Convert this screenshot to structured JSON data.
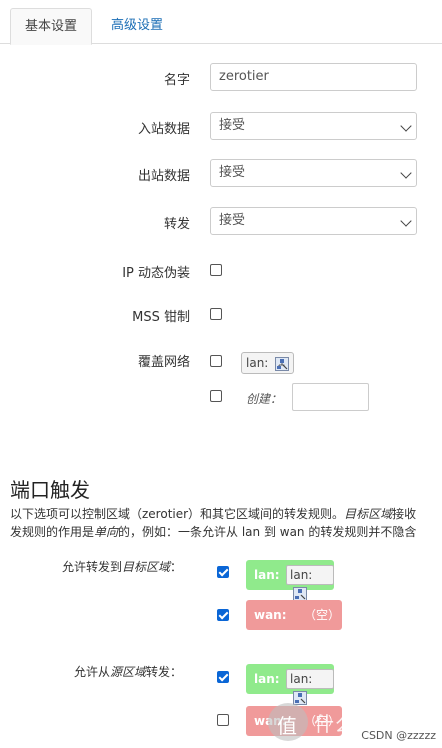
{
  "tabs": {
    "basic": "基本设置",
    "advanced": "高级设置"
  },
  "form": {
    "name_label": "名字",
    "name_value": "zerotier",
    "input_label": "入站数据",
    "input_value": "接受",
    "output_label": "出站数据",
    "output_value": "接受",
    "forward_label": "转发",
    "forward_value": "接受",
    "masq_label": "IP 动态伪装",
    "mss_label": "MSS 钳制",
    "covered_label": "覆盖网络",
    "covered_lan": "lan:",
    "create_label": "创建："
  },
  "port_forward": {
    "title": "端口触发",
    "desc_line1_a": "以下选项可以控制区域（zerotier）和其它区域间的转发规则。",
    "desc_line1_b": "目标区域",
    "desc_line1_c": "接收",
    "desc_line2_a": "发规则的作用是",
    "desc_line2_b": "单向",
    "desc_line2_c": "的，例如：一条允许从 lan 到 wan 的转发规则并不隐含",
    "dest_label_a": "允许转发到",
    "dest_label_b": "目标区域",
    "dest_label_c": "：",
    "src_label_a": "允许从",
    "src_label_b": "源区域",
    "src_label_c": "转发：",
    "zone_lan": "lan:",
    "zone_lan_inner": "lan:",
    "zone_wan": "wan:",
    "zone_wan_empty": "（空）"
  },
  "watermark": {
    "csdn": "CSDN @zzzzz",
    "site": "什么值得买"
  },
  "colors": {
    "lan_zone": "#90ea8c",
    "wan_zone": "#f09a9a",
    "link": "#1a6db5",
    "check": "#0a66d6"
  }
}
